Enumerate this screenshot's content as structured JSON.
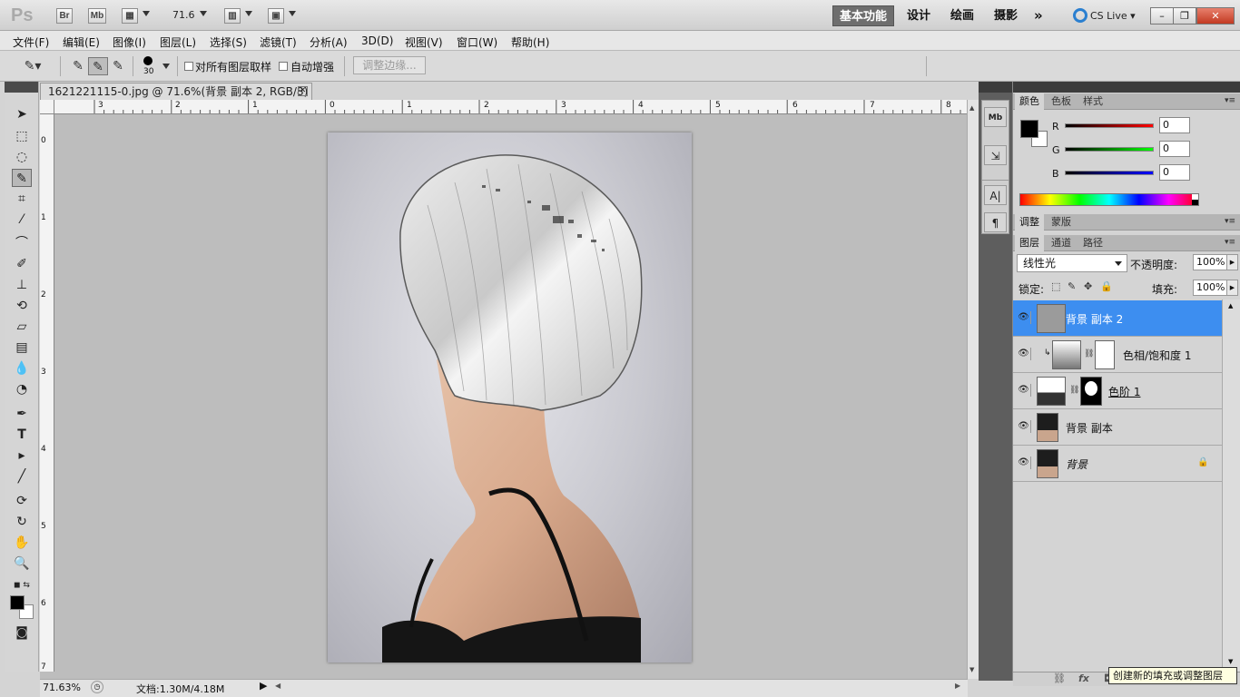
{
  "titlebar": {
    "logo": "Ps",
    "btn_bridge": "Br",
    "btn_minibridge": "Mb",
    "zoom_value": "71.6",
    "workspaces": [
      "基本功能",
      "设计",
      "绘画",
      "摄影"
    ],
    "more": "»",
    "cslive": "CS Live",
    "win_min": "–",
    "win_restore": "❐",
    "win_close": "✕"
  },
  "menu": [
    "文件(F)",
    "编辑(E)",
    "图像(I)",
    "图层(L)",
    "选择(S)",
    "滤镜(T)",
    "分析(A)",
    "3D(D)",
    "视图(V)",
    "窗口(W)",
    "帮助(H)"
  ],
  "options": {
    "brush_size": "30",
    "sample_all_layers": "对所有图层取样",
    "auto_enhance": "自动增强",
    "refine_edge": "调整边缘..."
  },
  "document": {
    "tab_title": "1621221115-0.jpg @ 71.6%(背景 副本 2, RGB/8) *",
    "tab_close": "✕",
    "ruler_top": [
      "3",
      "2",
      "1",
      "0",
      "1",
      "2",
      "3",
      "4",
      "5",
      "6",
      "7",
      "8"
    ],
    "ruler_left": [
      "0",
      "1",
      "2",
      "3",
      "4",
      "5",
      "6",
      "7"
    ]
  },
  "status": {
    "zoom": "71.63%",
    "doc_size": "文档:1.30M/4.18M"
  },
  "color_panel": {
    "tabs": [
      "颜色",
      "色板",
      "样式"
    ],
    "channels": [
      {
        "label": "R",
        "value": "0",
        "color": "#d41010"
      },
      {
        "label": "G",
        "value": "0",
        "color": "#10b010"
      },
      {
        "label": "B",
        "value": "0",
        "color": "#1020c8"
      }
    ]
  },
  "adjust_panel": {
    "tabs": [
      "调整",
      "蒙版"
    ]
  },
  "layers_panel": {
    "tabs": [
      "图层",
      "通道",
      "路径"
    ],
    "blend_mode": "线性光",
    "opacity_label": "不透明度:",
    "opacity_value": "100%",
    "lock_label": "锁定:",
    "fill_label": "填充:",
    "fill_value": "100%",
    "layers": [
      {
        "name": "背景 副本 2",
        "selected": true
      },
      {
        "name": "色相/饱和度 1",
        "selected": false
      },
      {
        "name": "色阶 1",
        "selected": false
      },
      {
        "name": "背景 副本",
        "selected": false
      },
      {
        "name": "背景",
        "selected": false
      }
    ]
  },
  "tooltip": "创建新的填充或调整图层",
  "colors": {
    "selected_layer": "#3d8ef0",
    "active_workspace": "#6e6e6e"
  }
}
